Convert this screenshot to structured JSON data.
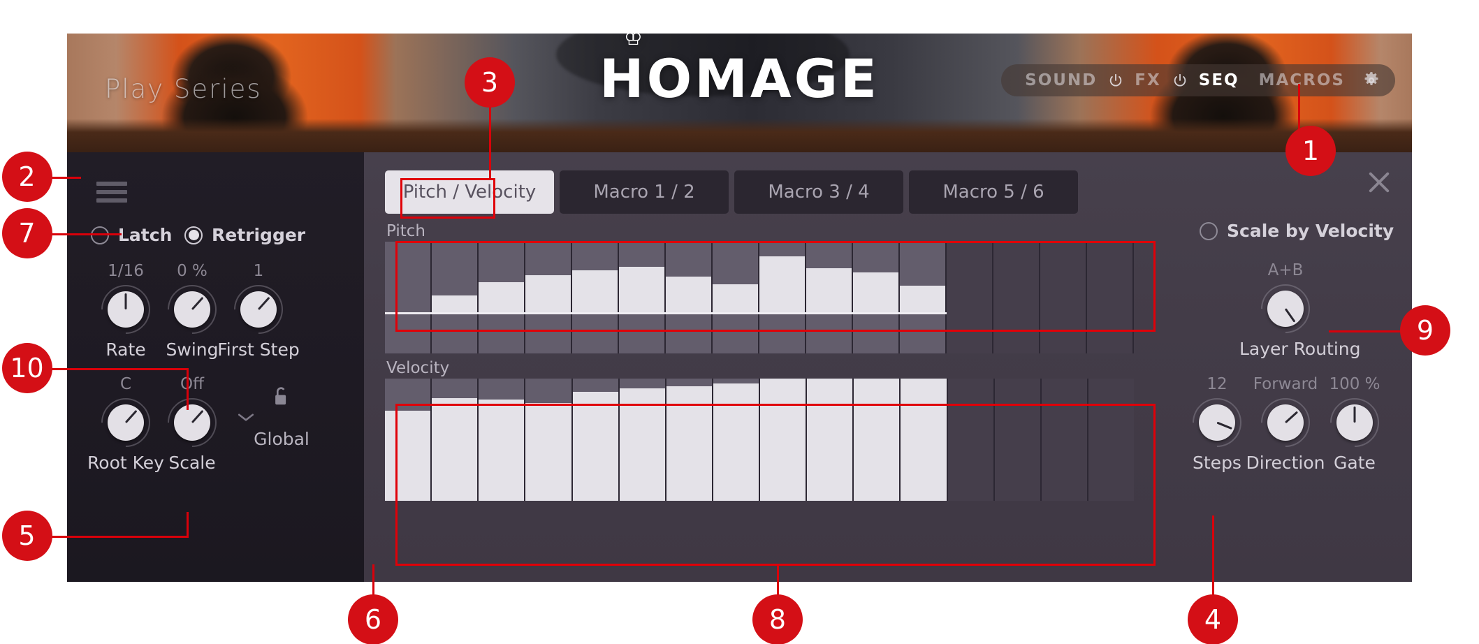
{
  "header": {
    "brand_sub": "Play Series",
    "logo": "HOMAGE",
    "crown_icon": "crown-icon",
    "ring_icon": "ring-indicator-icon",
    "nav": [
      {
        "label": "SOUND",
        "active": false
      },
      {
        "label": "FX",
        "active": false
      },
      {
        "label": "SEQ",
        "active": true
      },
      {
        "label": "MACROS",
        "active": false
      }
    ],
    "gear_icon": "gear-icon",
    "power_icon": "power-icon"
  },
  "window": {
    "menu_icon": "hamburger-menu-icon",
    "close_icon": "close-icon"
  },
  "tabs": [
    {
      "label": "Pitch / Velocity",
      "active": true
    },
    {
      "label": "Macro 1 / 2",
      "active": false
    },
    {
      "label": "Macro 3 / 4",
      "active": false
    },
    {
      "label": "Macro 5 / 6",
      "active": false
    }
  ],
  "left_panel": {
    "toggles": [
      {
        "label": "Latch",
        "on": false
      },
      {
        "label": "Retrigger",
        "on": true
      }
    ],
    "knobs_row1": [
      {
        "value": "1/16",
        "label": "Rate",
        "angle": 0
      },
      {
        "value": "0 %",
        "label": "Swing",
        "angle": -138
      },
      {
        "value": "1",
        "label": "First Step",
        "angle": -138
      }
    ],
    "knobs_row2": [
      {
        "value": "C",
        "label": "Root Key",
        "angle": -138
      },
      {
        "value": "Off",
        "label": "Scale",
        "angle": -138
      }
    ],
    "scale_chevron_icon": "chevron-down-icon",
    "global": {
      "label": "Global",
      "icon": "unlocked-padlock-icon"
    }
  },
  "right_panel": {
    "toggle": {
      "label": "Scale by Velocity",
      "on": false
    },
    "layer_routing": {
      "value": "A+B",
      "label": "Layer Routing",
      "angle": 145
    },
    "knobs": [
      {
        "value": "12",
        "label": "Steps",
        "angle": 68
      },
      {
        "value": "Forward",
        "label": "Direction",
        "angle": -132
      },
      {
        "value": "100 %",
        "label": "Gate",
        "angle": 0
      }
    ]
  },
  "sequencer": {
    "pitch_title": "Pitch",
    "velocity_title": "Velocity",
    "total_steps": 16,
    "active_steps": 12,
    "pitch_values": [
      0,
      24,
      42,
      52,
      59,
      64,
      50,
      40,
      79,
      62,
      56,
      38
    ],
    "velocity_values": [
      74,
      84,
      83,
      80,
      89,
      92,
      94,
      96,
      100,
      100,
      100,
      100
    ]
  },
  "callouts": [
    {
      "n": "1"
    },
    {
      "n": "2"
    },
    {
      "n": "3"
    },
    {
      "n": "4"
    },
    {
      "n": "5"
    },
    {
      "n": "6"
    },
    {
      "n": "7"
    },
    {
      "n": "8"
    },
    {
      "n": "9"
    },
    {
      "n": "10"
    }
  ],
  "colors": {
    "accent_red": "#d40f16",
    "highlight_red": "#e00008",
    "panel_dark": "#1e1a23",
    "panel_main": "#433c48",
    "bar_light": "#e4e2e8",
    "step_active": "#635d6c",
    "step_inactive": "#453e4b"
  }
}
